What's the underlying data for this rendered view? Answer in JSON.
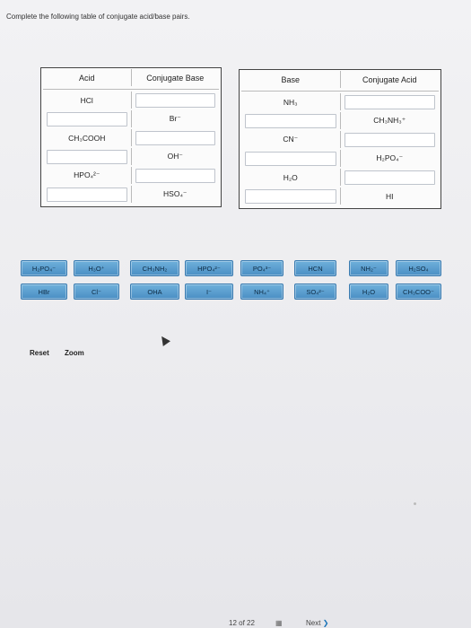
{
  "instruction": "Complete the following table of conjugate acid/base pairs.",
  "left_table": {
    "headers": [
      "Acid",
      "Conjugate Base"
    ],
    "rows": [
      [
        "HCl",
        ""
      ],
      [
        "",
        "Br⁻"
      ],
      [
        "CH₃COOH",
        ""
      ],
      [
        "",
        "OH⁻"
      ],
      [
        "HPO₄²⁻",
        ""
      ],
      [
        "",
        "HSO₄⁻"
      ]
    ]
  },
  "right_table": {
    "headers": [
      "Base",
      "Conjugate Acid"
    ],
    "rows": [
      [
        "NH₃",
        ""
      ],
      [
        "",
        "CH₃NH₃⁺"
      ],
      [
        "CN⁻",
        ""
      ],
      [
        "",
        "H₂PO₄⁻"
      ],
      [
        "H₂O",
        ""
      ],
      [
        "",
        "HI"
      ]
    ]
  },
  "tiles_row1": [
    "H₂PO₄⁻",
    "H₃O⁺",
    "CH₃NH₂",
    "HPO₄²⁻",
    "PO₄³⁻",
    "HCN",
    "NH₂⁻",
    "H₂SO₄"
  ],
  "tiles_row2": [
    "HBr",
    "Cl⁻",
    "OHA",
    "I⁻",
    "NH₄⁺",
    "SO₄²⁻",
    "H₂O",
    "CH₃COO⁻"
  ],
  "controls": {
    "reset": "Reset",
    "zoom": "Zoom"
  },
  "footer": {
    "page": "12 of 22",
    "next": "Next"
  }
}
